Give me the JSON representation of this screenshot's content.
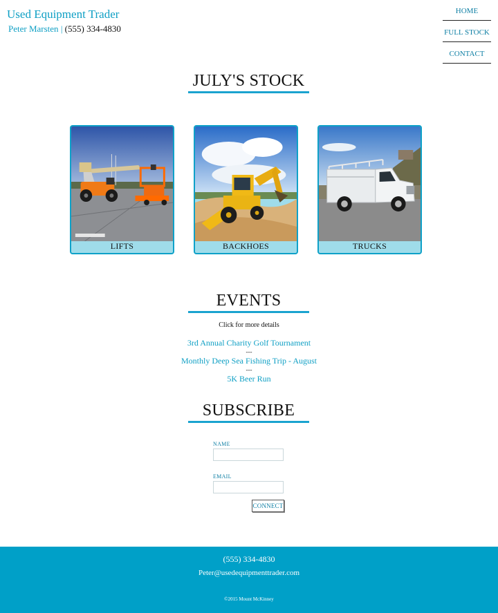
{
  "brand": {
    "name": "Used Equipment Trader",
    "person": "Peter Marsten",
    "separator": "|",
    "phone": "(555) 334-4830"
  },
  "nav": {
    "items": [
      {
        "label": "HOME"
      },
      {
        "label": "FULL STOCK"
      },
      {
        "label": "CONTACT"
      }
    ]
  },
  "stock": {
    "title": "JULY'S STOCK",
    "cards": [
      {
        "label": "LIFTS"
      },
      {
        "label": "BACKHOES"
      },
      {
        "label": "TRUCKS"
      }
    ]
  },
  "events": {
    "title": "EVENTS",
    "hint": "Click for more details",
    "separator": "---",
    "items": [
      {
        "label": "3rd Annual Charity Golf Tournament"
      },
      {
        "label": "Monthly Deep Sea Fishing Trip - August"
      },
      {
        "label": "5K Beer Run"
      }
    ]
  },
  "subscribe": {
    "title": "SUBSCRIBE",
    "name_label": "NAME",
    "email_label": "EMAIL",
    "button_label": "CONNECT"
  },
  "footer": {
    "phone": "(555) 334-4830",
    "email": "Peter@usedequipmenttrader.com",
    "copyright": "©2015 Mount McKinney"
  },
  "colors": {
    "accent": "#0ea1c8",
    "footer_bg": "#00a0c8",
    "card_label_bg": "#9fdcea"
  }
}
